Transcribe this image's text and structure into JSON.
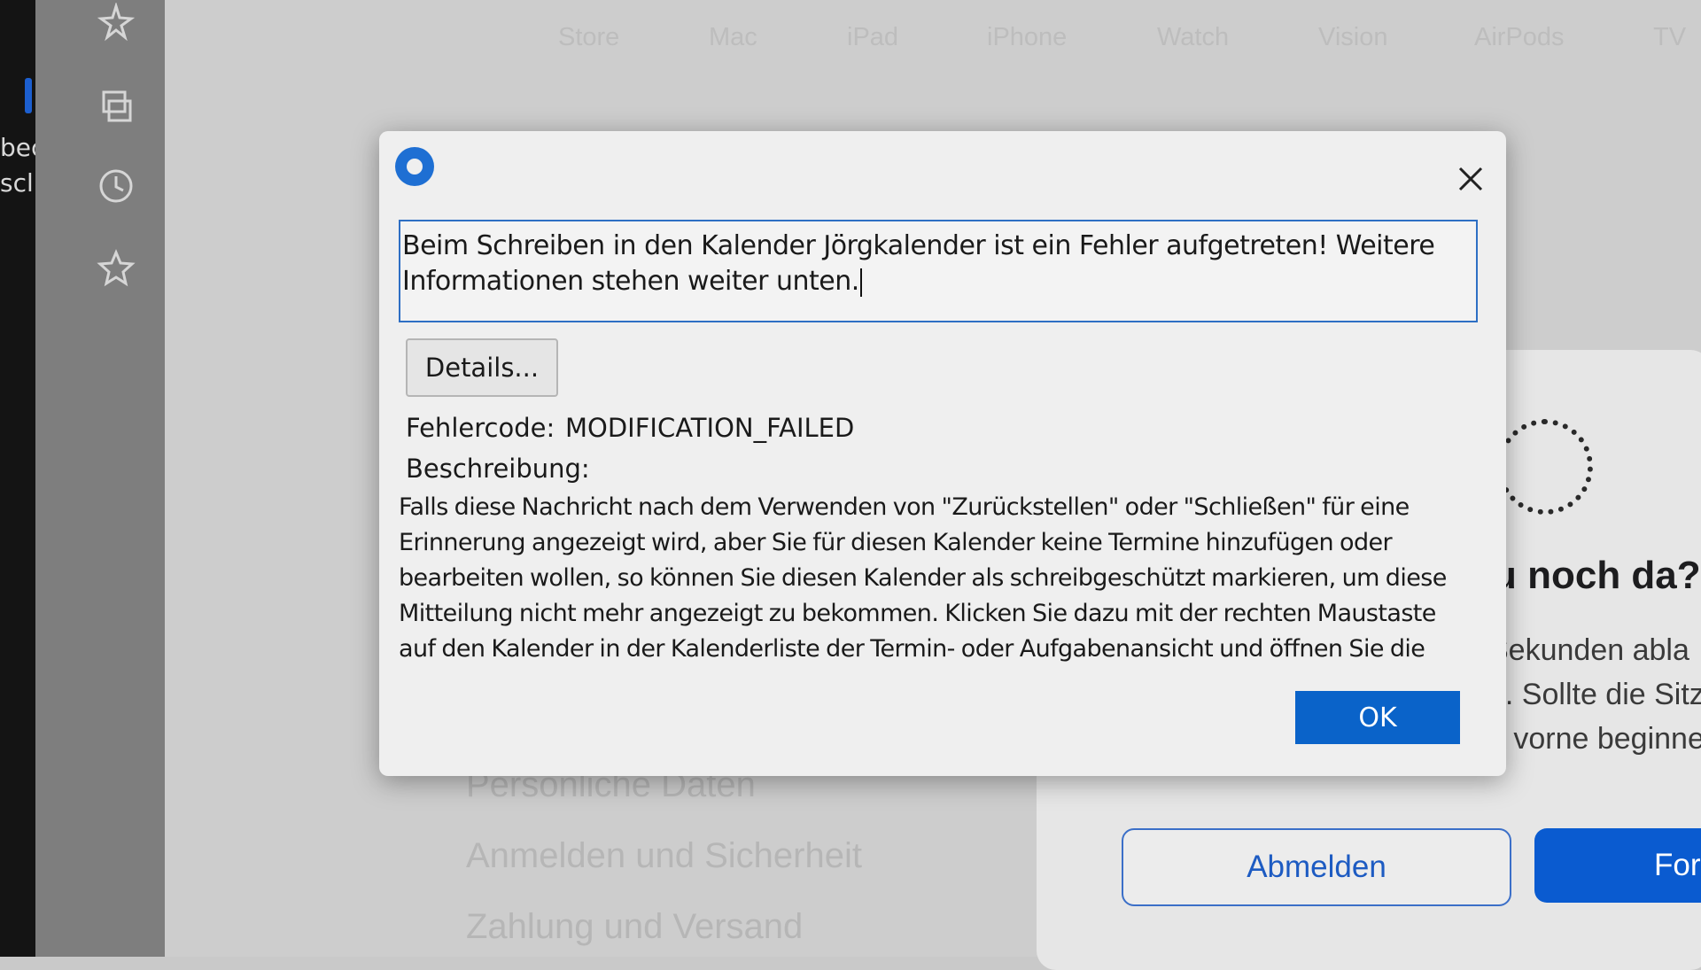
{
  "left_strip": {
    "line1": "bec",
    "line2": "scl"
  },
  "icon_bar": {
    "icons": [
      "sparkle-star-icon",
      "tab-stack-icon",
      "history-clock-icon",
      "favorites-star-icon"
    ]
  },
  "background_page": {
    "nav": [
      "Store",
      "Mac",
      "iPad",
      "iPhone",
      "Watch",
      "Vision",
      "AirPods",
      "TV"
    ],
    "menu": [
      "Persönliche Daten",
      "Anmelden und Sicherheit",
      "Zahlung und Versand"
    ]
  },
  "background_dialog": {
    "heading": "u noch da?",
    "line1": "Sekunden abla",
    "line2": "n. Sollte die Sitz",
    "line3": "n vorne beginne",
    "sign_out_label": "Abmelden",
    "continue_label": "For"
  },
  "dialog": {
    "message": "Beim Schreiben in den Kalender Jörgkalender ist ein Fehler aufgetreten! Weitere Informationen stehen weiter unten.",
    "details_label": "Details...",
    "error_code_label": "Fehlercode:",
    "error_code_value": "MODIFICATION_FAILED",
    "description_label": "Beschreibung:",
    "description_text": "Falls diese Nachricht nach dem Verwenden von \"Zurückstellen\" oder \"Schließen\" für eine Erinnerung angezeigt wird, aber Sie für diesen Kalender keine Termine hinzufügen oder bearbeiten wollen, so können Sie diesen Kalender als schreibgeschützt markieren, um diese Mitteilung nicht mehr angezeigt zu bekommen. Klicken Sie dazu mit der rechten Maustaste auf den Kalender in der Kalenderliste der Termin- oder Aufgabenansicht und öffnen Sie die",
    "ok_label": "OK"
  }
}
